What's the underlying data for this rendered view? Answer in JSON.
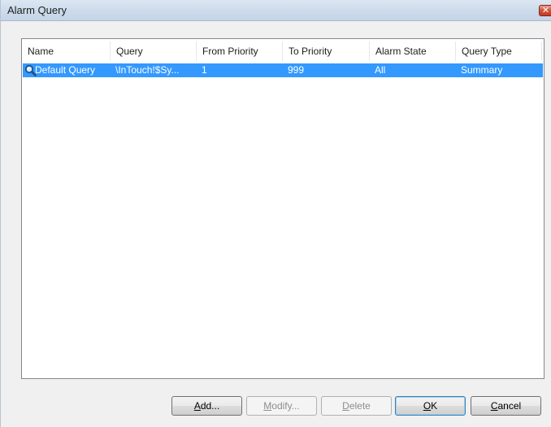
{
  "window": {
    "title": "Alarm Query",
    "close_glyph": "✕"
  },
  "listview": {
    "columns": [
      "Name",
      "Query",
      "From Priority",
      "To Priority",
      "Alarm State",
      "Query Type"
    ],
    "rows": [
      {
        "icon": "magnifier-icon",
        "name": "Default Query",
        "query": "\\InTouch!$Sy...",
        "from_priority": "1",
        "to_priority": "999",
        "alarm_state": "All",
        "query_type": "Summary",
        "selected": true
      }
    ],
    "selection_color": "#3399ff"
  },
  "buttons": {
    "add": {
      "pre": "",
      "accel": "A",
      "post": "dd...",
      "enabled": true
    },
    "modify": {
      "pre": "",
      "accel": "M",
      "post": "odify...",
      "enabled": false
    },
    "delete": {
      "pre": "",
      "accel": "D",
      "post": "elete",
      "enabled": false
    },
    "ok": {
      "pre": "",
      "accel": "O",
      "post": "K",
      "enabled": true
    },
    "cancel": {
      "pre": "",
      "accel": "C",
      "post": "ancel",
      "enabled": true
    }
  }
}
